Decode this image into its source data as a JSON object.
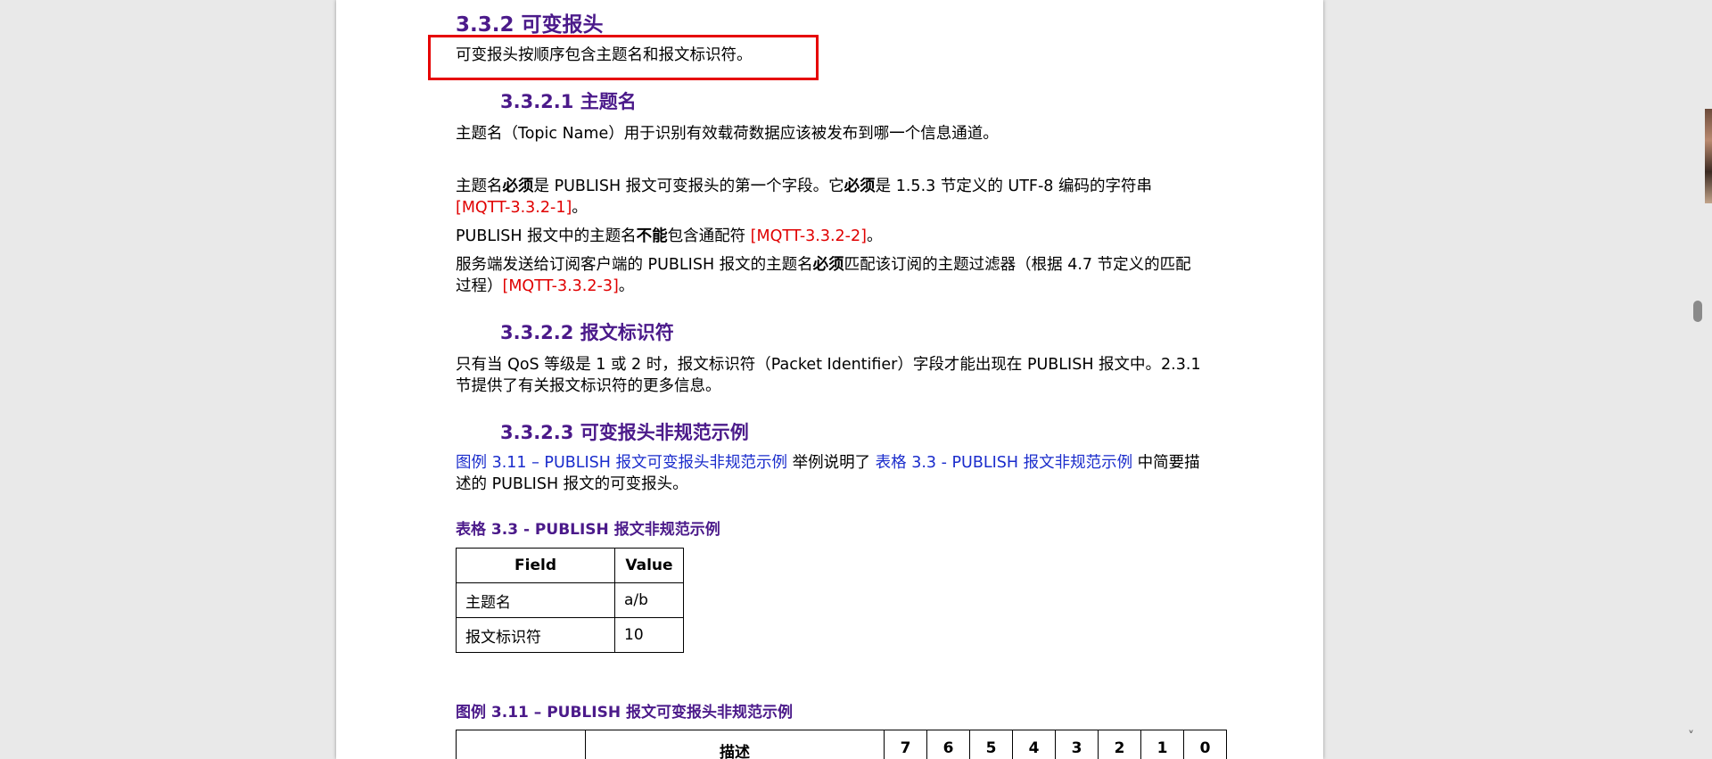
{
  "section": {
    "title": "3.3.2 可变报头",
    "intro": "可变报头按顺序包含主题名和报文标识符。"
  },
  "topic_name": {
    "title": "3.3.2.1 主题名",
    "p1": "主题名（Topic Name）用于识别有效载荷数据应该被发布到哪一个信息通道。",
    "p2_a": "主题名",
    "p2_b": "必须",
    "p2_c": "是 PUBLISH 报文可变报头的第一个字段。它",
    "p2_d": "必须",
    "p2_e": "是 1.5.3 节定义的 UTF-8 编码的字符串",
    "p2_ref": "[MQTT-3.3.2-1]",
    "p2_end": "。",
    "p3_a": "PUBLISH 报文中的主题名",
    "p3_b": "不能",
    "p3_c": "包含通配符 ",
    "p3_ref": "[MQTT-3.3.2-2]",
    "p3_end": "。",
    "p4_a": "服务端发送给订阅客户端的 PUBLISH 报文的主题名",
    "p4_b": "必须",
    "p4_c": "匹配该订阅的主题过滤器（根据 4.7 节定义的匹配",
    "p4_line2": "过程）",
    "p4_ref": "[MQTT-3.3.2-3]",
    "p4_end": "。"
  },
  "packet_id": {
    "title": "3.3.2.2 报文标识符",
    "line1": "只有当 QoS 等级是 1 或 2 时，报文标识符（Packet Identifier）字段才能出现在 PUBLISH 报文中。2.3.1",
    "line2": "节提供了有关报文标识符的更多信息。"
  },
  "example": {
    "title": "3.3.2.3 可变报头非规范示例",
    "link1": "图例 3.11 – PUBLISH 报文可变报头非规范示例",
    "mid": " 举例说明了 ",
    "link2": "表格 3.3 - PUBLISH 报文非规范示例",
    "tail": " 中简要描",
    "line2": "述的 PUBLISH 报文的可变报头。"
  },
  "table1": {
    "caption": "表格 3.3 - PUBLISH 报文非规范示例",
    "headers": [
      "Field",
      "Value"
    ],
    "rows": [
      [
        "主题名",
        "a/b"
      ],
      [
        "报文标识符",
        "10"
      ]
    ]
  },
  "figure": {
    "caption": "图例 3.11 – PUBLISH 报文可变报头非规范示例",
    "headers": [
      "",
      "描述",
      "7",
      "6",
      "5",
      "4",
      "3",
      "2",
      "1",
      "0"
    ]
  },
  "colors": {
    "heading": "#4b1a8a",
    "reference": "#e00000",
    "link": "#1a2ccc",
    "highlight_box": "#e60000"
  }
}
